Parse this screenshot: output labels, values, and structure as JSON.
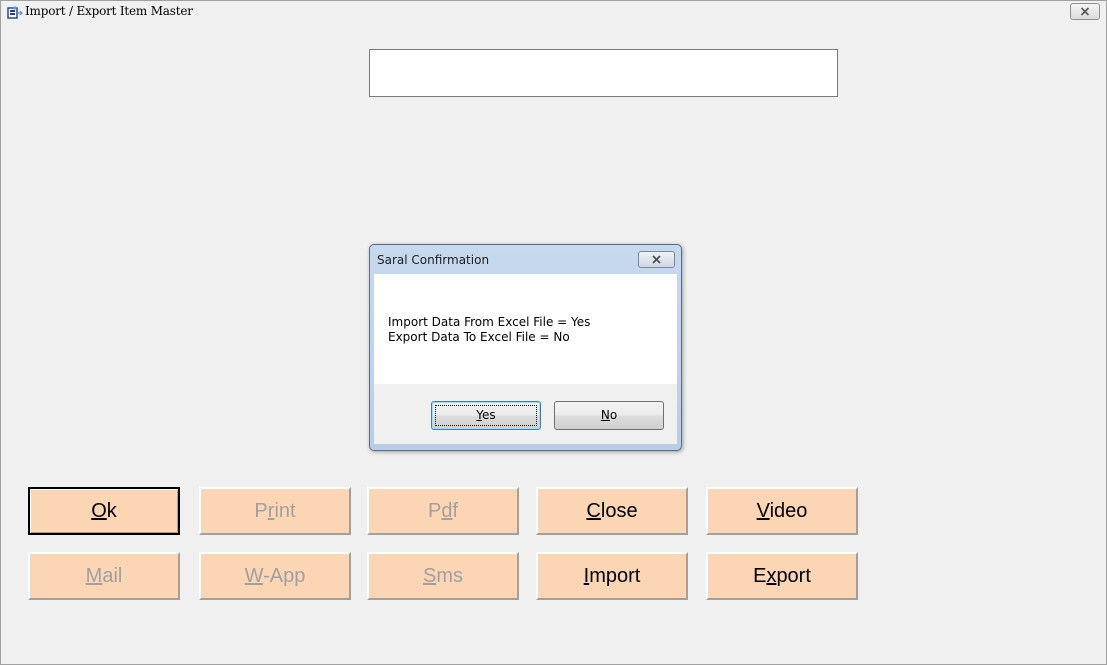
{
  "window": {
    "title": "Import / Export Item Master",
    "icon": "app-icon"
  },
  "top_field": {
    "value": ""
  },
  "dialog": {
    "title": "Saral Confirmation",
    "message_line1": "Import Data From Excel File = Yes",
    "message_line2": "Export Data To Excel File = No",
    "yes_label": {
      "pre": "",
      "key": "Y",
      "post": "es"
    },
    "no_label": {
      "pre": "",
      "key": "N",
      "post": "o"
    }
  },
  "buttons": {
    "ok": {
      "pre": "",
      "key": "O",
      "post": "k",
      "enabled": true
    },
    "print": {
      "pre": "P",
      "key": "r",
      "post": "int",
      "enabled": false
    },
    "pdf": {
      "pre": "P",
      "key": "d",
      "post": "f",
      "enabled": false
    },
    "close": {
      "pre": "",
      "key": "C",
      "post": "lose",
      "enabled": true
    },
    "video": {
      "pre": "",
      "key": "V",
      "post": "ideo",
      "enabled": true
    },
    "mail": {
      "pre": "",
      "key": "M",
      "post": "ail",
      "enabled": false
    },
    "wapp": {
      "pre": "",
      "key": "W",
      "post": "-App",
      "enabled": false
    },
    "sms": {
      "pre": "",
      "key": "S",
      "post": "ms",
      "enabled": false
    },
    "import": {
      "pre": "",
      "key": "I",
      "post": "mport",
      "enabled": true
    },
    "export": {
      "pre": "E",
      "key": "x",
      "post": "port",
      "enabled": true
    }
  },
  "colors": {
    "button_bg": "#fcd5b4",
    "disabled_text": "#a0a0a0",
    "dialog_frame": "#b8cde6"
  }
}
